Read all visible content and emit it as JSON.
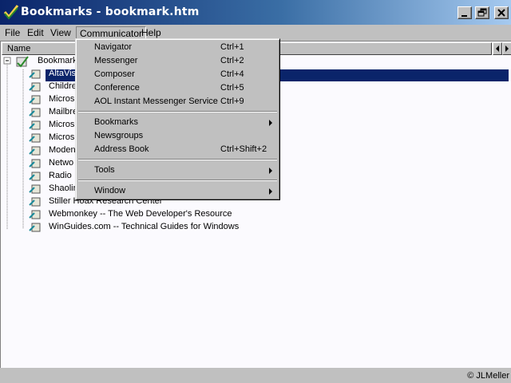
{
  "window": {
    "title": "Bookmarks - bookmark.htm"
  },
  "menubar": [
    "File",
    "Edit",
    "View",
    "Communicator",
    "Help"
  ],
  "column_header": "Name",
  "tree": {
    "root": "Bookmark",
    "items": [
      "AltaVis",
      "Childre",
      "Micros",
      "Mailbre",
      "Micros",
      "Micros",
      "Moden",
      "Netwo",
      "Radio",
      "Shaolir",
      "Stiller Hoax Research Center",
      "Webmonkey -- The Web Developer's Resource",
      "WinGuides.com -- Technical Guides for Windows"
    ]
  },
  "communicator_menu": {
    "group1": [
      {
        "label": "Navigator",
        "shortcut": "Ctrl+1"
      },
      {
        "label": "Messenger",
        "shortcut": "Ctrl+2"
      },
      {
        "label": "Composer",
        "shortcut": "Ctrl+4"
      },
      {
        "label": "Conference",
        "shortcut": "Ctrl+5"
      },
      {
        "label": "AOL Instant Messenger Service",
        "shortcut": "Ctrl+9"
      }
    ],
    "group2": [
      {
        "label": "Bookmarks",
        "submenu": true
      },
      {
        "label": "Newsgroups"
      },
      {
        "label": "Address Book",
        "shortcut": "Ctrl+Shift+2"
      }
    ],
    "tools": {
      "label": "Tools",
      "submenu": true
    },
    "window": {
      "label": "Window",
      "submenu": true
    }
  },
  "status": {
    "copyright": "© JLMeller"
  },
  "colors": {
    "titlebar_start": "#0a246a",
    "titlebar_end": "#a6caf0",
    "selection": "#0a246a",
    "face": "#c0c0c0"
  }
}
